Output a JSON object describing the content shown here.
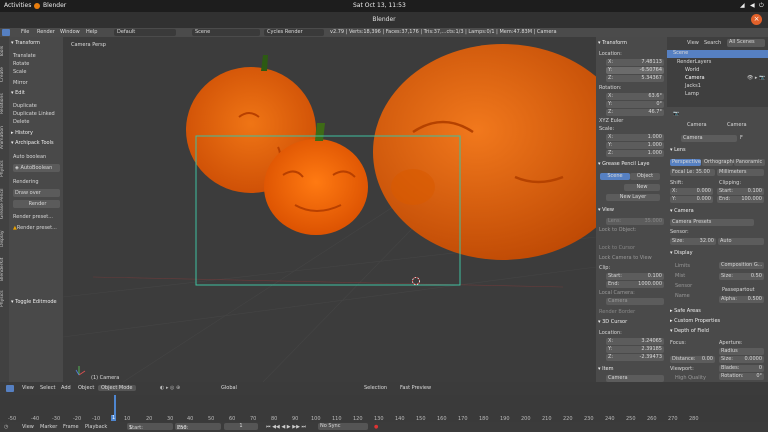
{
  "topbar": {
    "activities": "Activities",
    "app": "Blender",
    "clock": "Sat Oct 13, 11:53"
  },
  "window": {
    "title": "Blender",
    "close": "×"
  },
  "infobar": {
    "menus": [
      "File",
      "Render",
      "Window",
      "Help"
    ],
    "layout": "Default",
    "scene": "Scene",
    "engine": "Cycles Render",
    "stats": "v2.79 | Verts:18,396 | Faces:37,176 | Tris:37,...cts:1/3 | Lamps:0/1 | Mem:47.83M | Camera"
  },
  "left_tabs": [
    "Tools",
    "Create",
    "Relations",
    "Animation",
    "Physics",
    "Grease Pencil",
    "Display",
    "BlenderKit",
    "Physics"
  ],
  "toolshelf": {
    "transform_header": "Transform",
    "translate": "Translate",
    "rotate": "Rotate",
    "scale": "Scale",
    "mirror": "Mirror",
    "edit_header": "Edit",
    "duplicate": "Duplicate",
    "duplicate_linked": "Duplicate Linked",
    "delete": "Delete",
    "history_header": "History",
    "archipack_header": "Archipack Tools",
    "auto_boolean": "Auto boolean",
    "autoboolean_btn": "AutoBoolean",
    "rendering": "Rendering",
    "draw_over": "Draw over",
    "render_btn": "Render",
    "render_preset1": "Render preset...",
    "render_preset2": "Render preset...",
    "toggle_editmode": "Toggle Editmode"
  },
  "viewport": {
    "persp_label": "Camera Persp",
    "object_label": "(1) Camera"
  },
  "n_panel": {
    "transform": "Transform",
    "location": "Location:",
    "loc": [
      {
        "axis": "X:",
        "value": "7.48113"
      },
      {
        "axis": "Y:",
        "value": "-6.50764"
      },
      {
        "axis": "Z:",
        "value": "5.34367"
      }
    ],
    "rotation": "Rotation:",
    "rot": [
      {
        "axis": "X:",
        "value": "63.6°"
      },
      {
        "axis": "Y:",
        "value": "0°"
      },
      {
        "axis": "Z:",
        "value": "46.7°"
      }
    ],
    "euler": "XYZ Euler",
    "scale": "Scale:",
    "scl": [
      {
        "axis": "X:",
        "value": "1.000"
      },
      {
        "axis": "Y:",
        "value": "1.000"
      },
      {
        "axis": "Z:",
        "value": "1.000"
      }
    ],
    "grease_pencil": "Grease Pencil Laye",
    "gp_scene": "Scene",
    "gp_object": "Object",
    "gp_new": "New",
    "gp_new_layer": "New Layer",
    "view": "View",
    "lens": "Lens:",
    "lens_val": "35.000",
    "lock_to_object": "Lock to Object:",
    "lock_to_cursor": "Lock to Cursor",
    "lock_camera": "Lock Camera to View",
    "clip": "Clip:",
    "clip_start": "Start:",
    "clip_start_val": "0.100",
    "clip_end": "End:",
    "clip_end_val": "1000.000",
    "local_camera": "Local Camera:",
    "camera": "Camera",
    "render_border": "Render Border",
    "cursor_3d": "3D Cursor",
    "cur_location": "Location:",
    "cur": [
      {
        "axis": "X:",
        "value": "3.24065"
      },
      {
        "axis": "Y:",
        "value": "2.39185"
      },
      {
        "axis": "Z:",
        "value": "-2.39473"
      }
    ],
    "item": "Item",
    "item_name": "Camera"
  },
  "outliner": {
    "view": "View",
    "search": "Search",
    "scenes": "All Scenes",
    "items": [
      {
        "name": "Scene"
      },
      {
        "name": "RenderLayers"
      },
      {
        "name": "World"
      },
      {
        "name": "Camera"
      },
      {
        "name": "Jacks1"
      },
      {
        "name": "Lamp"
      }
    ]
  },
  "properties": {
    "crumb1": "Camera",
    "crumb2": "Camera",
    "datablock": "Camera",
    "f_label": "F",
    "lens_header": "Lens",
    "tabs": [
      "Perspective",
      "Orthographic",
      "Panoramic"
    ],
    "focal": "Focal Le: 35.00",
    "units": "Millimeters",
    "shift": "Shift:",
    "clipping": "Clipping:",
    "shift_x": "X:",
    "shift_x_val": "0.000",
    "shift_y": "Y:",
    "shift_y_val": "0.000",
    "clip_start": "Start:",
    "clip_start_val": "0.100",
    "clip_end": "End:",
    "clip_end_val": "100.000",
    "camera_header": "Camera",
    "camera_presets": "Camera Presets",
    "sensor": "Sensor:",
    "size": "Size:",
    "size_val": "32.00",
    "fit": "Auto",
    "display_header": "Display",
    "limits": "Limits",
    "composition": "Composition G...",
    "mist": "Mist",
    "size_label": "Size:",
    "size_disp": "0.50",
    "sensor_cb": "Sensor",
    "passepartout": "Passepartout",
    "name_cb": "Name",
    "alpha": "Alpha:",
    "alpha_val": "0.500",
    "safe_areas": "Safe Areas",
    "custom_props": "Custom Properties",
    "dof_header": "Depth of Field",
    "focus": "Focus:",
    "aperture": "Aperture:",
    "radius": "Radius",
    "distance": "Distance:",
    "distance_val": "0.00",
    "ap_size": "Size:",
    "ap_size_val": "0.0000",
    "viewport": "Viewport:",
    "blades": "Blades:",
    "blades_val": "0",
    "hq": "High Quality",
    "rotation": "Rotation:",
    "rotation_val": "0°",
    "fstop": "F-stop:",
    "fstop_val": "128.0",
    "ratio": "Ratio:",
    "ratio_val": "1.0000"
  },
  "vpheader": {
    "view": "View",
    "select": "Select",
    "add": "Add",
    "object": "Object",
    "mode": "Object Mode",
    "pivot": "Global",
    "selection": "Selection",
    "fast_preview": "Fast Preview"
  },
  "timeline": {
    "ticks": [
      "-50",
      "-40",
      "-30",
      "-20",
      "-10",
      "0",
      "10",
      "20",
      "30",
      "40",
      "50",
      "60",
      "70",
      "80",
      "90",
      "100",
      "110",
      "120",
      "130",
      "140",
      "150",
      "160",
      "170",
      "180",
      "190",
      "200",
      "210",
      "220",
      "230",
      "240",
      "250",
      "260",
      "270",
      "280"
    ],
    "current_frame": "1"
  },
  "tlfooter": {
    "view": "View",
    "marker": "Marker",
    "frame": "Frame",
    "playback": "Playback",
    "start": "Start:",
    "start_val": "1",
    "end": "End:",
    "end_val": "250",
    "frame_val": "1",
    "sync": "No Sync"
  },
  "colors": {
    "pumpkin": "#ff6a00",
    "camera_frame": "#3ec0a0",
    "blender_orange": "#e87d0d",
    "accent": "#5680c2"
  }
}
